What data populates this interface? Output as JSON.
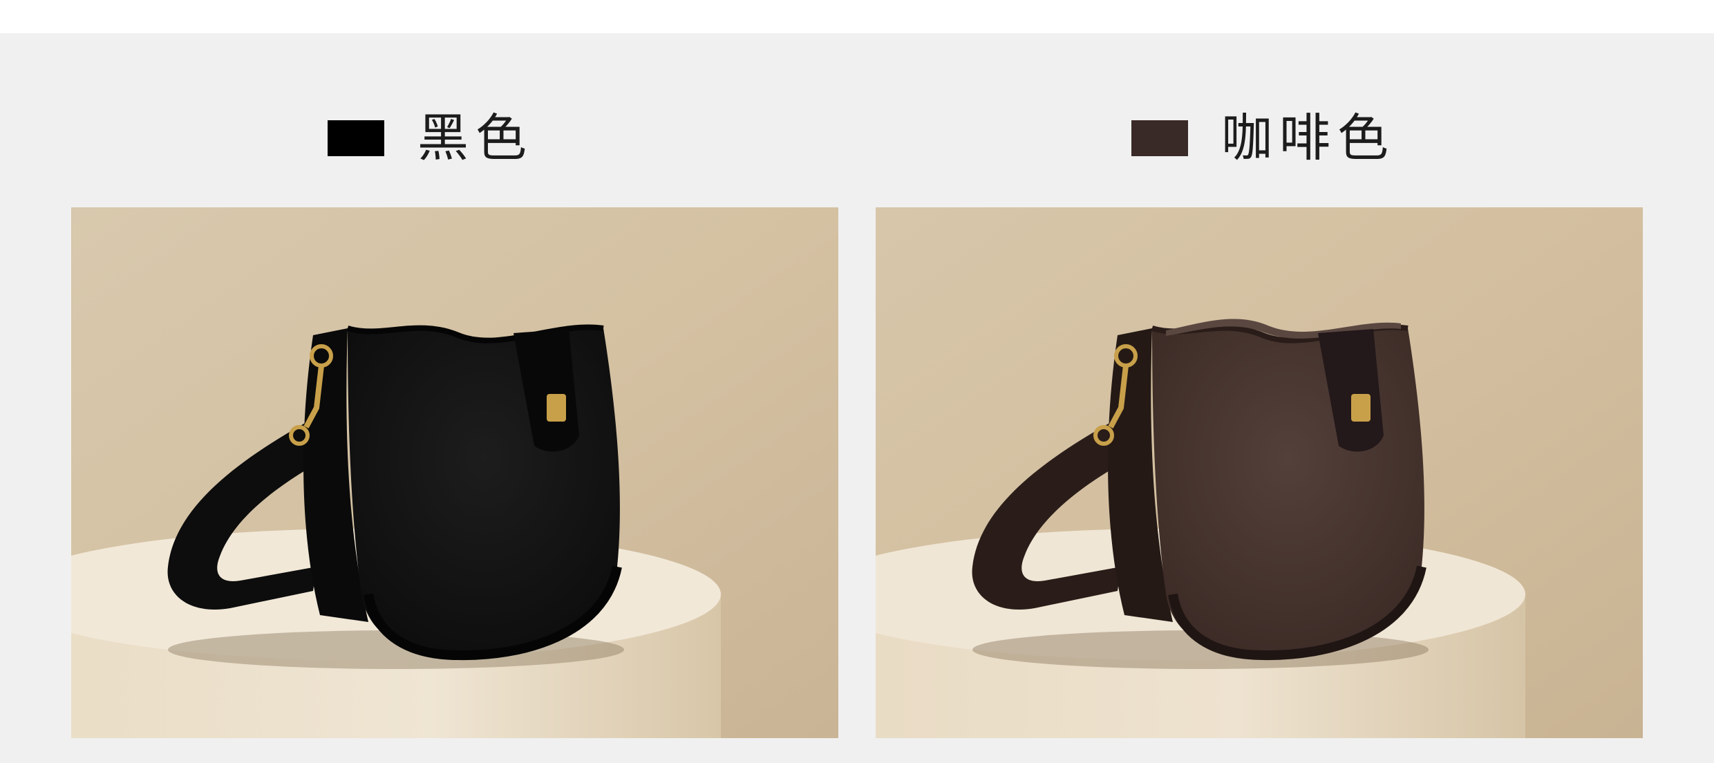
{
  "variants": [
    {
      "label": "黑色",
      "swatch_color": "#000000",
      "bag_body": "#111111",
      "bag_suede": "#1a1a1a",
      "bag_trim": "#0a0a0a",
      "inner": "#222222"
    },
    {
      "label": "咖啡色",
      "swatch_color": "#3a2a27",
      "bag_body": "#2e211d",
      "bag_suede": "#4a3630",
      "bag_trim": "#241915",
      "inner": "#5a4740"
    }
  ],
  "colors": {
    "backdrop": "#d3c1a4",
    "pedestal": "#eadfcb",
    "hardware": "#c8a04a",
    "panel_bg": "#f0f0f0"
  }
}
